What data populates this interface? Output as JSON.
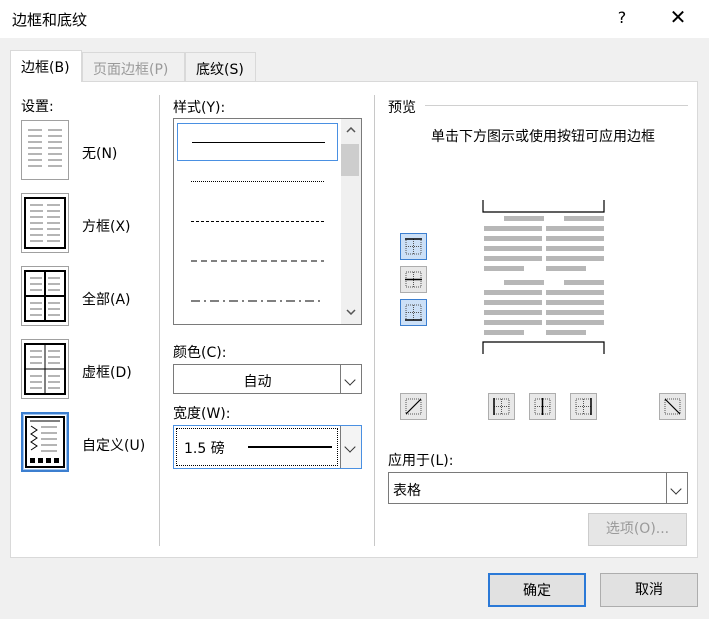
{
  "window": {
    "title": "边框和底纹",
    "help": "?",
    "close": "✕"
  },
  "tabs": [
    {
      "label": "边框(B)"
    },
    {
      "label": "页面边框(P)"
    },
    {
      "label": "底纹(S)"
    }
  ],
  "settings": {
    "label": "设置:",
    "items": [
      {
        "label": "无(N)"
      },
      {
        "label": "方框(X)"
      },
      {
        "label": "全部(A)"
      },
      {
        "label": "虚框(D)"
      },
      {
        "label": "自定义(U)"
      }
    ]
  },
  "style": {
    "label": "样式(Y):",
    "items": [
      "solid",
      "dotted",
      "dashed-small",
      "dashed",
      "dash-dot"
    ]
  },
  "color": {
    "label": "颜色(C):",
    "value": "自动"
  },
  "width": {
    "label": "宽度(W):",
    "value": "1.5 磅"
  },
  "preview": {
    "label": "预览",
    "hint": "单击下方图示或使用按钮可应用边框"
  },
  "apply": {
    "label": "应用于(L):",
    "value": "表格"
  },
  "buttons": {
    "options": "选项(O)...",
    "ok": "确定",
    "cancel": "取消"
  },
  "colors": {
    "accent": "#2b79d7",
    "panel": "#ffffff",
    "background": "#f0f0f0"
  }
}
